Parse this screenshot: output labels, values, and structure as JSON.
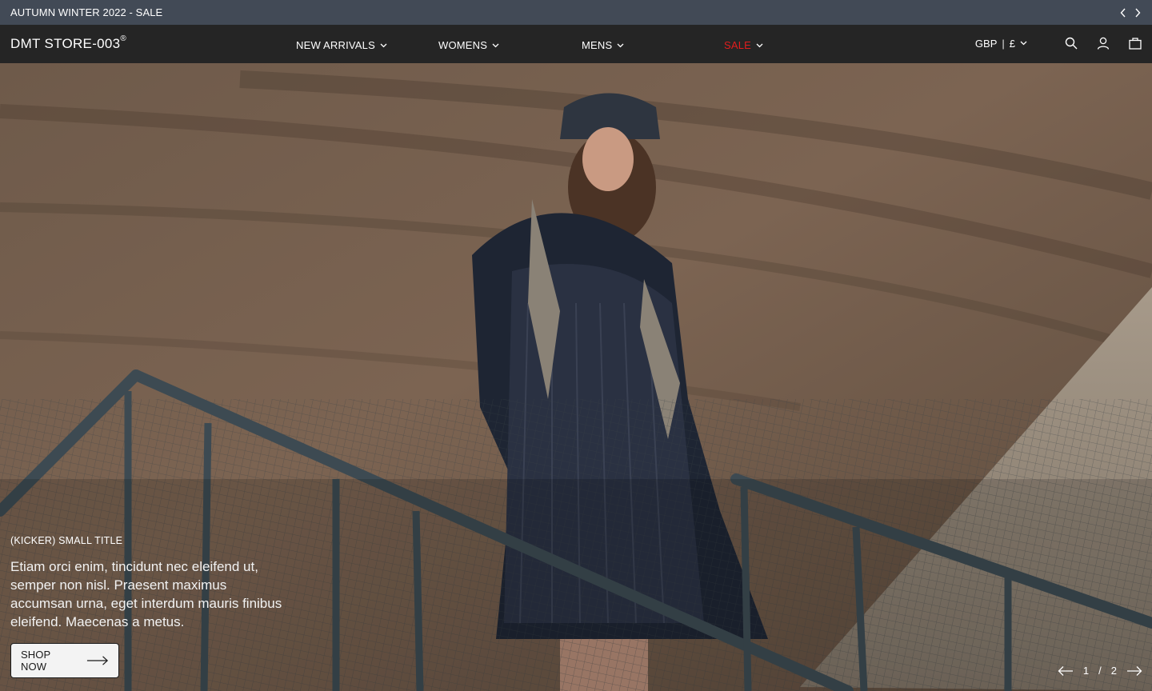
{
  "announcement": {
    "text": "AUTUMN WINTER 2022 - SALE",
    "prev_icon": "chevron-left-icon",
    "next_icon": "chevron-right-icon"
  },
  "header": {
    "logo": "DMT STORE-003",
    "logo_mark": "®",
    "nav": [
      {
        "label": "NEW ARRIVALS",
        "icon": "chevron-down-icon"
      },
      {
        "label": "WOMENS",
        "icon": "chevron-down-icon"
      },
      {
        "label": "MENS",
        "icon": "chevron-down-icon"
      },
      {
        "label": "SALE",
        "icon": "chevron-down-icon",
        "color": "#e11d1d"
      }
    ],
    "currency": {
      "code": "GBP",
      "separator": "|",
      "symbol": "£"
    },
    "icons": [
      "search-icon",
      "account-icon",
      "bag-icon"
    ]
  },
  "hero": {
    "kicker": "(KICKER) SMALL TITLE",
    "body": "Etiam orci enim, tincidunt nec eleifend ut, semper non nisl. Praesent maximus accumsan urna, eget interdum mauris finibus eleifend. Maecenas a  metus.",
    "cta_label": "SHOP NOW",
    "pager": {
      "current": "1",
      "divider": "/",
      "total": "2"
    }
  },
  "colors": {
    "announcement_bg": "#424a56",
    "header_bg": "#252525",
    "sale_red": "#e11d1d"
  }
}
